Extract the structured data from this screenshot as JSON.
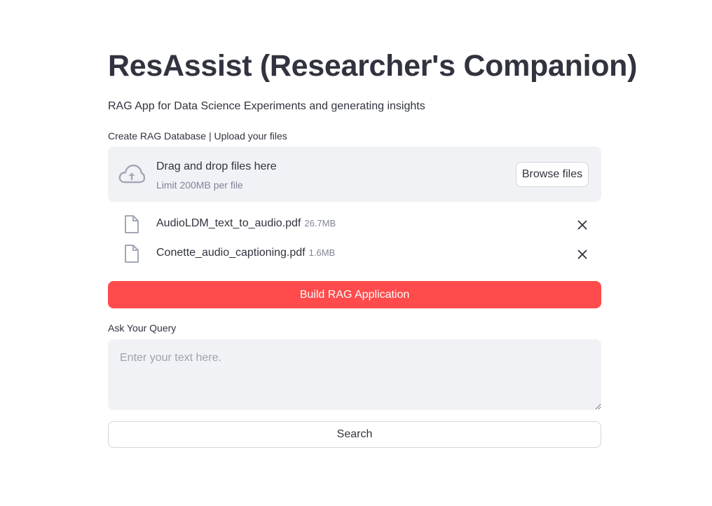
{
  "app": {
    "title": "ResAssist (Researcher's Companion)",
    "subtitle": "RAG App for Data Science Experiments and generating insights"
  },
  "uploader": {
    "label": "Create RAG Database | Upload your files",
    "drop_text": "Drag and drop files here",
    "limit_text": "Limit 200MB per file",
    "browse_label": "Browse files",
    "icon": "cloud-upload-icon",
    "files": [
      {
        "name": "AudioLDM_text_to_audio.pdf",
        "size": "26.7MB"
      },
      {
        "name": "Conette_audio_captioning.pdf",
        "size": "1.6MB"
      }
    ]
  },
  "build_button": {
    "label": "Build RAG Application"
  },
  "query": {
    "label": "Ask Your Query",
    "placeholder": "Enter your text here.",
    "value": ""
  },
  "search_button": {
    "label": "Search"
  },
  "colors": {
    "primary": "#ff4b4b",
    "text": "#31333f",
    "input_bg": "#f0f2f6",
    "muted": "#808495"
  }
}
